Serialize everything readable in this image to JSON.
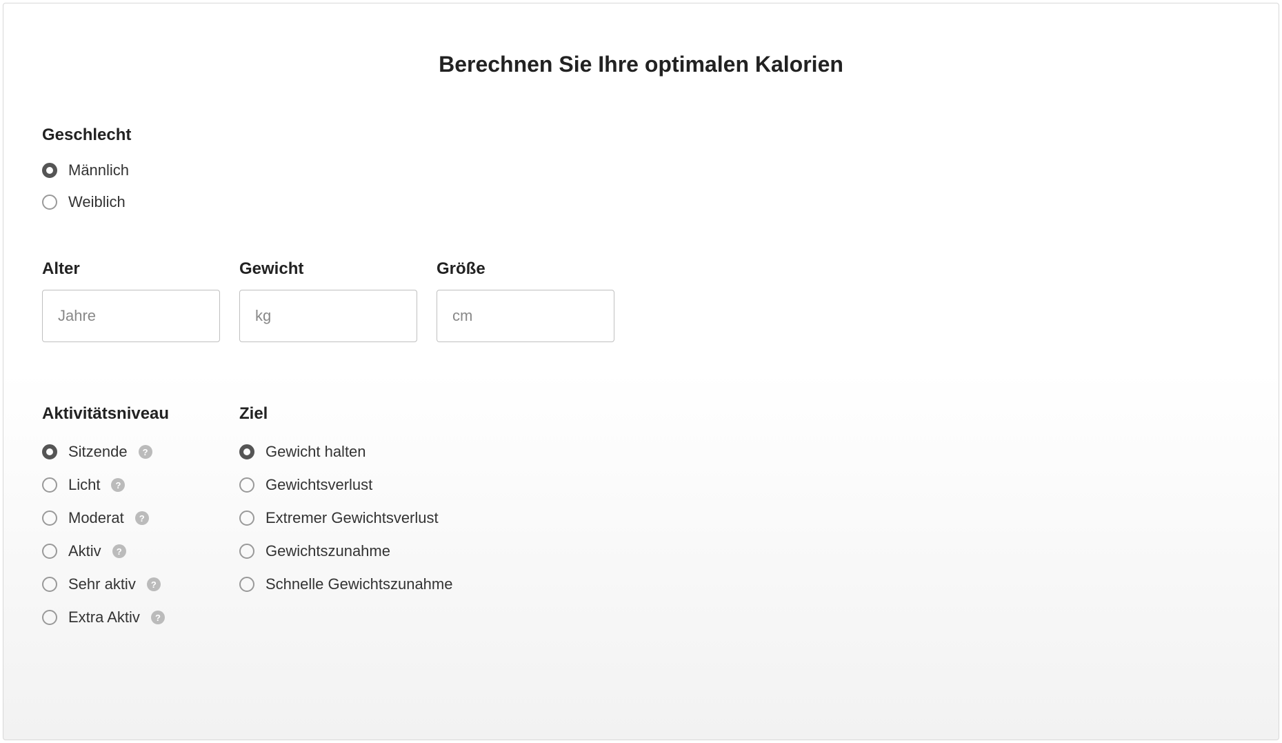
{
  "title": "Berechnen Sie Ihre optimalen Kalorien",
  "gender": {
    "label": "Geschlecht",
    "options": {
      "male": "Männlich",
      "female": "Weiblich"
    }
  },
  "inputs": {
    "age": {
      "label": "Alter",
      "placeholder": "Jahre"
    },
    "weight": {
      "label": "Gewicht",
      "placeholder": "kg"
    },
    "height": {
      "label": "Größe",
      "placeholder": "cm"
    }
  },
  "activity": {
    "label": "Aktivitätsniveau",
    "options": {
      "sedentary": "Sitzende",
      "light": "Licht",
      "moderate": "Moderat",
      "active": "Aktiv",
      "very_active": "Sehr aktiv",
      "extra_active": "Extra Aktiv"
    }
  },
  "goal": {
    "label": "Ziel",
    "options": {
      "maintain": "Gewicht halten",
      "loss": "Gewichtsverlust",
      "extreme_loss": "Extremer Gewichtsverlust",
      "gain": "Gewichtszunahme",
      "fast_gain": "Schnelle Gewichtszunahme"
    }
  }
}
